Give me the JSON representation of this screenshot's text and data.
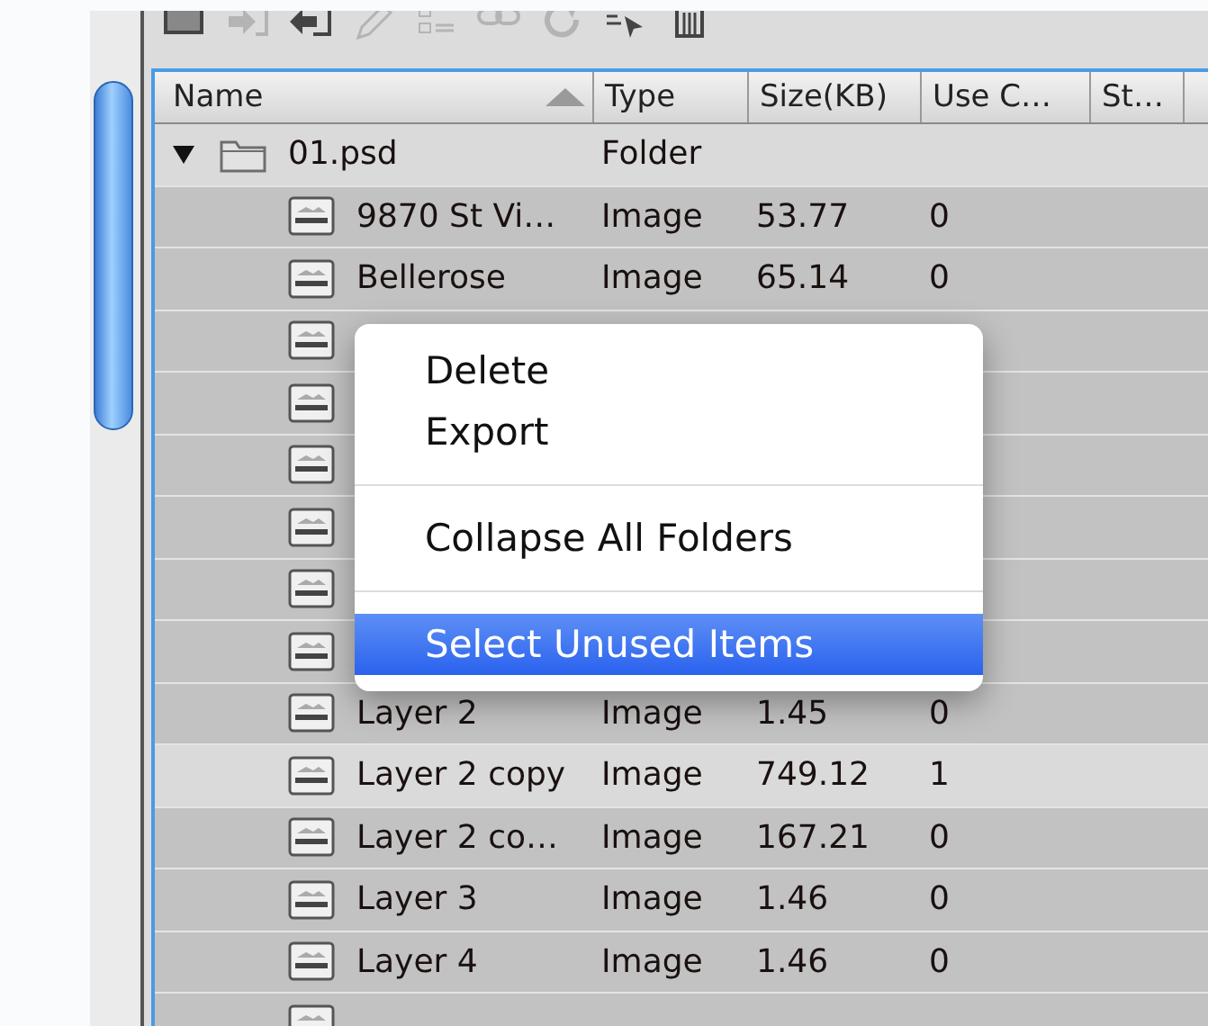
{
  "toolbar": [
    {
      "kind": "rectangle",
      "disabled": false
    },
    {
      "kind": "import",
      "disabled": true
    },
    {
      "kind": "export",
      "disabled": false
    },
    {
      "kind": "pencil",
      "disabled": true
    },
    {
      "kind": "list",
      "disabled": true
    },
    {
      "kind": "link",
      "disabled": true
    },
    {
      "kind": "refresh",
      "disabled": true
    },
    {
      "kind": "cursor",
      "disabled": false
    },
    {
      "kind": "trash",
      "disabled": false
    }
  ],
  "table": {
    "columns": [
      {
        "label": "Name",
        "sorted": true
      },
      {
        "label": "Type",
        "sorted": false
      },
      {
        "label": "Size(KB)",
        "sorted": false
      },
      {
        "label": "Use C…",
        "sorted": false
      },
      {
        "label": "St…",
        "sorted": false
      }
    ],
    "rows": [
      {
        "kind": "folder",
        "name": "01.psd",
        "type": "Folder",
        "expanded": true,
        "selected": false,
        "children": [
          {
            "kind": "image",
            "name": "9870 St Vi…",
            "type": "Image",
            "size": "53.77",
            "use_count": "0",
            "selected": true
          },
          {
            "kind": "image",
            "name": "Bellerose",
            "type": "Image",
            "size": "65.14",
            "use_count": "0",
            "selected": true
          },
          {
            "kind": "image",
            "selected": true
          },
          {
            "kind": "image",
            "selected": true
          },
          {
            "kind": "image",
            "selected": true
          },
          {
            "kind": "image",
            "selected": true
          },
          {
            "kind": "image",
            "selected": true
          },
          {
            "kind": "image",
            "selected": true
          },
          {
            "kind": "image",
            "name": "Layer 2",
            "type": "Image",
            "size": "1.45",
            "use_count": "0",
            "selected": true
          },
          {
            "kind": "image",
            "name": "Layer 2 copy",
            "type": "Image",
            "size": "749.12",
            "use_count": "1",
            "selected": false
          },
          {
            "kind": "image",
            "name": "Layer 2 co…",
            "type": "Image",
            "size": "167.21",
            "use_count": "0",
            "selected": true
          },
          {
            "kind": "image",
            "name": "Layer 3",
            "type": "Image",
            "size": "1.46",
            "use_count": "0",
            "selected": true
          },
          {
            "kind": "image",
            "name": "Layer 4",
            "type": "Image",
            "size": "1.46",
            "use_count": "0",
            "selected": true
          },
          {
            "kind": "image",
            "selected": true
          }
        ]
      }
    ]
  },
  "context_menu": {
    "items": [
      {
        "kind": "item",
        "label": "Delete",
        "selected": false
      },
      {
        "kind": "item",
        "label": "Export",
        "selected": false
      },
      {
        "kind": "separator"
      },
      {
        "kind": "item",
        "label": "Collapse All Folders",
        "selected": false
      },
      {
        "kind": "separator"
      },
      {
        "kind": "item",
        "label": "Select Unused Items",
        "selected": true
      }
    ]
  }
}
